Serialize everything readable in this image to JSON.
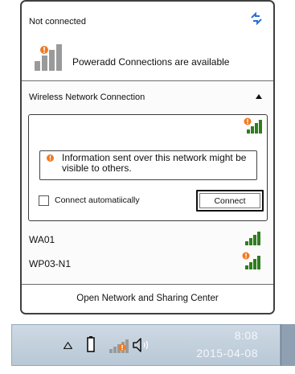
{
  "status": {
    "title": "Not connected"
  },
  "poweradd": {
    "label": "Poweradd Connections are available"
  },
  "wireless": {
    "header": "Wireless Network Connection"
  },
  "expanded": {
    "info_text": "Information sent over this network might be visible to others.",
    "auto_label": "Connect automatiically",
    "connect_label": "Connect"
  },
  "networks": [
    {
      "name": "WA01",
      "signal": "signal-bars-icon",
      "secured": false
    },
    {
      "name": "WP03-N1",
      "signal": "signal-bars-warning-icon",
      "secured": true
    }
  ],
  "footer": {
    "label": "Open Network and Sharing Center"
  },
  "taskbar": {
    "time": "8:08",
    "date": "2015-04-08"
  },
  "colors": {
    "signal_green": "#2f7d1f",
    "warning_orange": "#f07a24",
    "taskbar": "#c4d1de"
  }
}
